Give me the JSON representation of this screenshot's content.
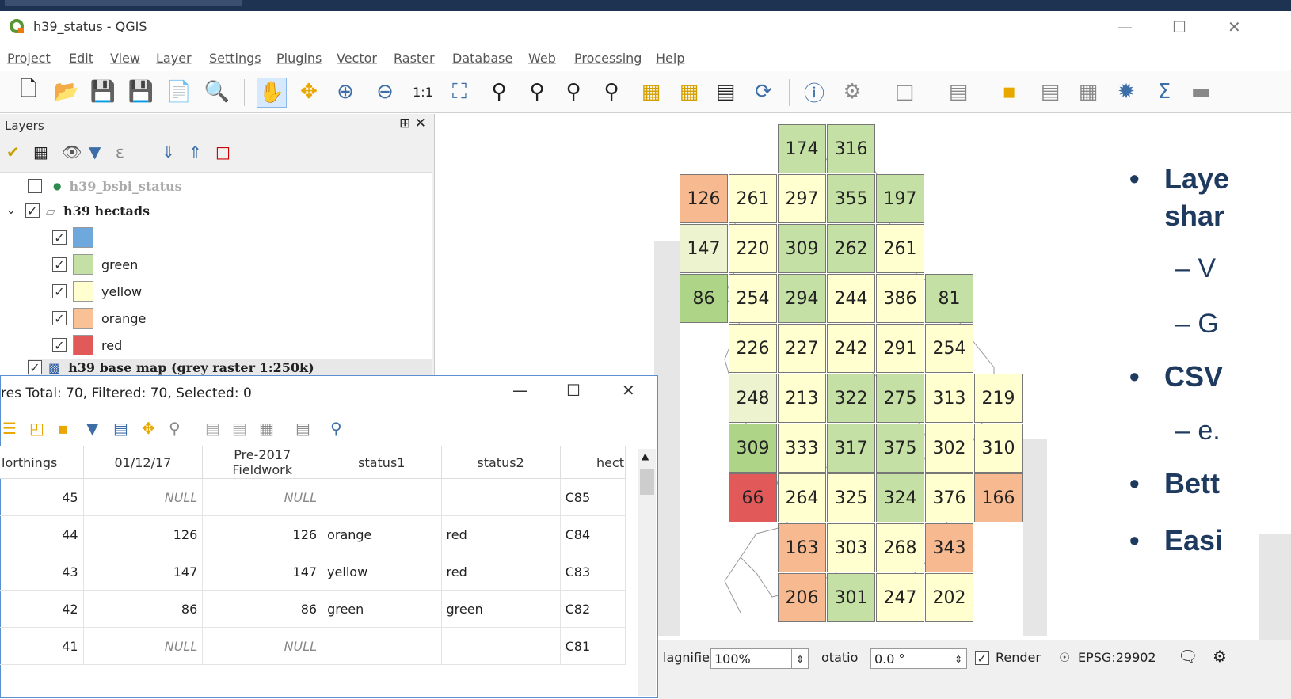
{
  "window": {
    "title": "h39_status - QGIS"
  },
  "menu": [
    "Project",
    "Edit",
    "View",
    "Layer",
    "Settings",
    "Plugins",
    "Vector",
    "Raster",
    "Database",
    "Web",
    "Processing",
    "Help"
  ],
  "layers_panel": {
    "title": "Layers",
    "items": [
      {
        "label": "h39_bsbi_status",
        "checked": false
      },
      {
        "label": "h39 hectads",
        "checked": true
      },
      {
        "label": "",
        "checked": true,
        "color": "#6fa8dc"
      },
      {
        "label": "green",
        "checked": true,
        "color": "#c5e0a5"
      },
      {
        "label": "yellow",
        "checked": true,
        "color": "#ffffd0"
      },
      {
        "label": "orange",
        "checked": true,
        "color": "#f9c195"
      },
      {
        "label": "red",
        "checked": true,
        "color": "#e2595a"
      },
      {
        "label": "h39 base map (grey raster 1:250k)",
        "checked": true
      }
    ]
  },
  "map": {
    "colors": {
      "green": "#c5e0a5",
      "yellow": "#ffffd0",
      "lightyellow": "#eef3cf",
      "orange": "#f7b98f",
      "red": "#e2595a",
      "darkgreen": "#aed487"
    },
    "cells": [
      {
        "v": "174",
        "c": "green"
      },
      {
        "v": "316",
        "c": "green"
      },
      {
        "v": "126",
        "c": "orange"
      },
      {
        "v": "261",
        "c": "yellow"
      },
      {
        "v": "297",
        "c": "yellow"
      },
      {
        "v": "355",
        "c": "green"
      },
      {
        "v": "197",
        "c": "green"
      },
      {
        "v": "147",
        "c": "lightyellow"
      },
      {
        "v": "220",
        "c": "yellow"
      },
      {
        "v": "309",
        "c": "green"
      },
      {
        "v": "262",
        "c": "green"
      },
      {
        "v": "261",
        "c": "yellow"
      },
      {
        "v": "86",
        "c": "darkgreen"
      },
      {
        "v": "254",
        "c": "yellow"
      },
      {
        "v": "294",
        "c": "green"
      },
      {
        "v": "244",
        "c": "yellow"
      },
      {
        "v": "386",
        "c": "yellow"
      },
      {
        "v": "81",
        "c": "green"
      },
      {
        "v": "226",
        "c": "yellow"
      },
      {
        "v": "227",
        "c": "yellow"
      },
      {
        "v": "242",
        "c": "yellow"
      },
      {
        "v": "291",
        "c": "yellow"
      },
      {
        "v": "254",
        "c": "yellow"
      },
      {
        "v": "248",
        "c": "lightyellow"
      },
      {
        "v": "213",
        "c": "yellow"
      },
      {
        "v": "322",
        "c": "green"
      },
      {
        "v": "275",
        "c": "green"
      },
      {
        "v": "313",
        "c": "yellow"
      },
      {
        "v": "219",
        "c": "yellow"
      },
      {
        "v": "309",
        "c": "darkgreen"
      },
      {
        "v": "333",
        "c": "yellow"
      },
      {
        "v": "317",
        "c": "green"
      },
      {
        "v": "375",
        "c": "green"
      },
      {
        "v": "302",
        "c": "yellow"
      },
      {
        "v": "310",
        "c": "yellow"
      },
      {
        "v": "66",
        "c": "red"
      },
      {
        "v": "264",
        "c": "yellow"
      },
      {
        "v": "325",
        "c": "yellow"
      },
      {
        "v": "324",
        "c": "green"
      },
      {
        "v": "376",
        "c": "yellow"
      },
      {
        "v": "166",
        "c": "orange"
      },
      {
        "v": "163",
        "c": "orange"
      },
      {
        "v": "303",
        "c": "yellow"
      },
      {
        "v": "268",
        "c": "yellow"
      },
      {
        "v": "343",
        "c": "orange"
      },
      {
        "v": "206",
        "c": "orange"
      },
      {
        "v": "301",
        "c": "green"
      },
      {
        "v": "247",
        "c": "yellow"
      },
      {
        "v": "202",
        "c": "yellow"
      }
    ]
  },
  "slide": {
    "bullets": [
      {
        "text": "Laye",
        "level": 1
      },
      {
        "text": "shar",
        "level": 1
      },
      {
        "text": "–  V",
        "level": 2
      },
      {
        "text": "–  G",
        "level": 2
      },
      {
        "text": "CSV",
        "level": 1
      },
      {
        "text": "–  e.",
        "level": 2
      },
      {
        "text": "Bett",
        "level": 1
      },
      {
        "text": "Easi",
        "level": 1
      }
    ]
  },
  "attribute_table": {
    "title": "res Total: 70, Filtered: 70, Selected: 0",
    "columns": [
      "lorthings",
      "01/12/17",
      "Pre-2017 Fieldwork",
      "status1",
      "status2",
      "hect"
    ],
    "rows": [
      [
        "45",
        "NULL",
        "NULL",
        "",
        "",
        "C85"
      ],
      [
        "44",
        "126",
        "126",
        "orange",
        "red",
        "C84"
      ],
      [
        "43",
        "147",
        "147",
        "yellow",
        "red",
        "C83"
      ],
      [
        "42",
        "86",
        "86",
        "green",
        "green",
        "C82"
      ],
      [
        "41",
        "NULL",
        "NULL",
        "",
        "",
        "C81"
      ]
    ]
  },
  "statusbar": {
    "magnifier_label": "lagnifie",
    "magnifier_value": "100%",
    "rotation_label": "otatio",
    "rotation_value": "0.0 °",
    "render_label": "Render",
    "crs": "EPSG:29902"
  }
}
